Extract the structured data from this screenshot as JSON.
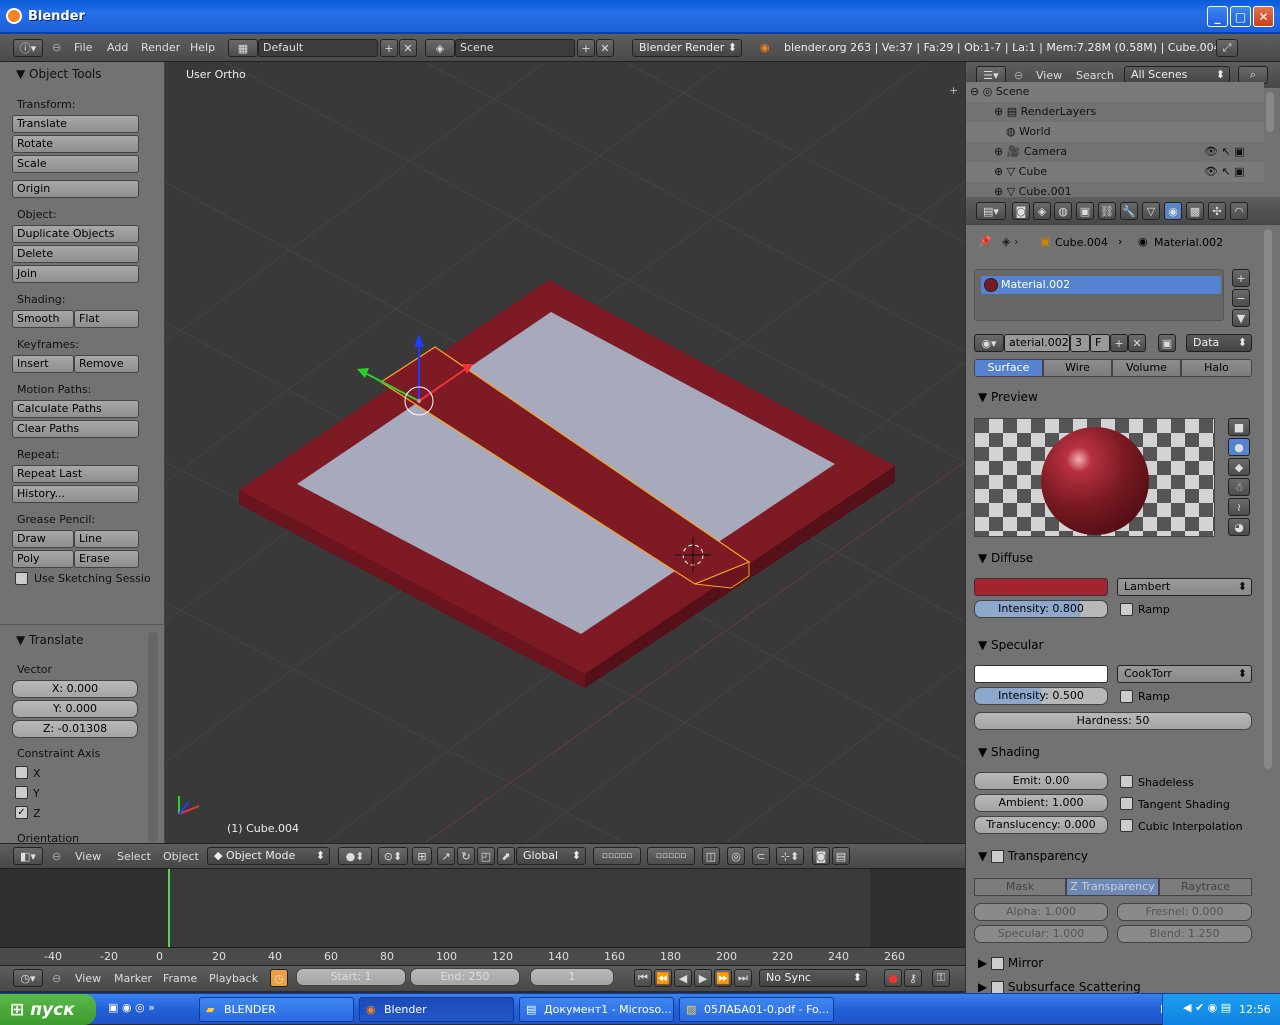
{
  "window": {
    "title": "Blender"
  },
  "info": {
    "menus": [
      "File",
      "Add",
      "Render",
      "Help"
    ],
    "layout": "Default",
    "scene": "Scene",
    "engine": "Blender Render",
    "stats": "blender.org 263 | Ve:37 | Fa:29 | Ob:1-7 | La:1 | Mem:7.28M (0.58M) | Cube.004"
  },
  "toolshelf": {
    "title": "Object Tools",
    "transform_label": "Transform:",
    "translate": "Translate",
    "rotate": "Rotate",
    "scale": "Scale",
    "origin": "Origin",
    "object_label": "Object:",
    "duplicate": "Duplicate Objects",
    "delete": "Delete",
    "join": "Join",
    "shading_label": "Shading:",
    "smooth": "Smooth",
    "flat": "Flat",
    "keyframes_label": "Keyframes:",
    "insert": "Insert",
    "remove": "Remove",
    "motion_label": "Motion Paths:",
    "calc_paths": "Calculate Paths",
    "clear_paths": "Clear Paths",
    "repeat_label": "Repeat:",
    "repeat_last": "Repeat Last",
    "history": "History...",
    "grease_label": "Grease Pencil:",
    "draw": "Draw",
    "line": "Line",
    "poly": "Poly",
    "erase": "Erase",
    "sketch": "Use Sketching Sessio"
  },
  "operator": {
    "title": "Translate",
    "vector_label": "Vector",
    "x": "X: 0.000",
    "y": "Y: 0.000",
    "z": "Z: -0.01308",
    "constraint_label": "Constraint Axis",
    "cx": "X",
    "cy": "Y",
    "cz": "Z",
    "orientation_label": "Orientation"
  },
  "viewport": {
    "view_name": "User Ortho",
    "object_name": "(1) Cube.004"
  },
  "viewport_header": {
    "menus": [
      "View",
      "Select",
      "Object"
    ],
    "mode": "Object Mode",
    "orientation": "Global"
  },
  "timeline": {
    "ruler": [
      "-40",
      "-20",
      "0",
      "20",
      "40",
      "60",
      "80",
      "100",
      "120",
      "140",
      "160",
      "180",
      "200",
      "220",
      "240",
      "260"
    ],
    "menus": [
      "View",
      "Marker",
      "Frame",
      "Playback"
    ],
    "start": "Start: 1",
    "end": "End: 250",
    "current": "1",
    "sync": "No Sync"
  },
  "outliner": {
    "menus": [
      "View",
      "Search"
    ],
    "filter": "All Scenes",
    "items": [
      "Scene",
      "RenderLayers",
      "World",
      "Camera",
      "Cube",
      "Cube.001"
    ]
  },
  "properties": {
    "breadcrumb_object": "Cube.004",
    "breadcrumb_material": "Material.002",
    "slot": "Material.002",
    "datablock": "aterial.002",
    "users": "3",
    "fake": "F",
    "link": "Data",
    "tabs": [
      "Surface",
      "Wire",
      "Volume",
      "Halo"
    ],
    "preview_label": "Preview",
    "diffuse_label": "Diffuse",
    "diffuse_shader": "Lambert",
    "diffuse_intensity": "Intensity: 0.800",
    "ramp": "Ramp",
    "specular_label": "Specular",
    "specular_shader": "CookTorr",
    "specular_intensity": "Intensity: 0.500",
    "hardness": "Hardness: 50",
    "shading_label": "Shading",
    "emit": "Emit: 0.00",
    "ambient": "Ambient: 1.000",
    "translucency": "Translucency: 0.000",
    "shadeless": "Shadeless",
    "tangent": "Tangent Shading",
    "cubic": "Cubic Interpolation",
    "transparency_label": "Transparency",
    "trans_tabs": [
      "Mask",
      "Z Transparency",
      "Raytrace"
    ],
    "alpha": "Alpha: 1.000",
    "fresnel": "Fresnel: 0.000",
    "specular2": "Specular: 1.000",
    "blend": "Blend: 1.250",
    "mirror_label": "Mirror",
    "sss_label": "Subsurface Scattering",
    "colors": {
      "diffuse": "#a3242e",
      "specular": "#ffffff",
      "material": "#7a1a22"
    }
  },
  "taskbar": {
    "start": "пуск",
    "tasks": [
      "BLENDER",
      "Blender",
      "Документ1 - Microso...",
      "05ЛАБА01-0.pdf - Fo..."
    ],
    "lang": "EN",
    "time": "12:56"
  }
}
